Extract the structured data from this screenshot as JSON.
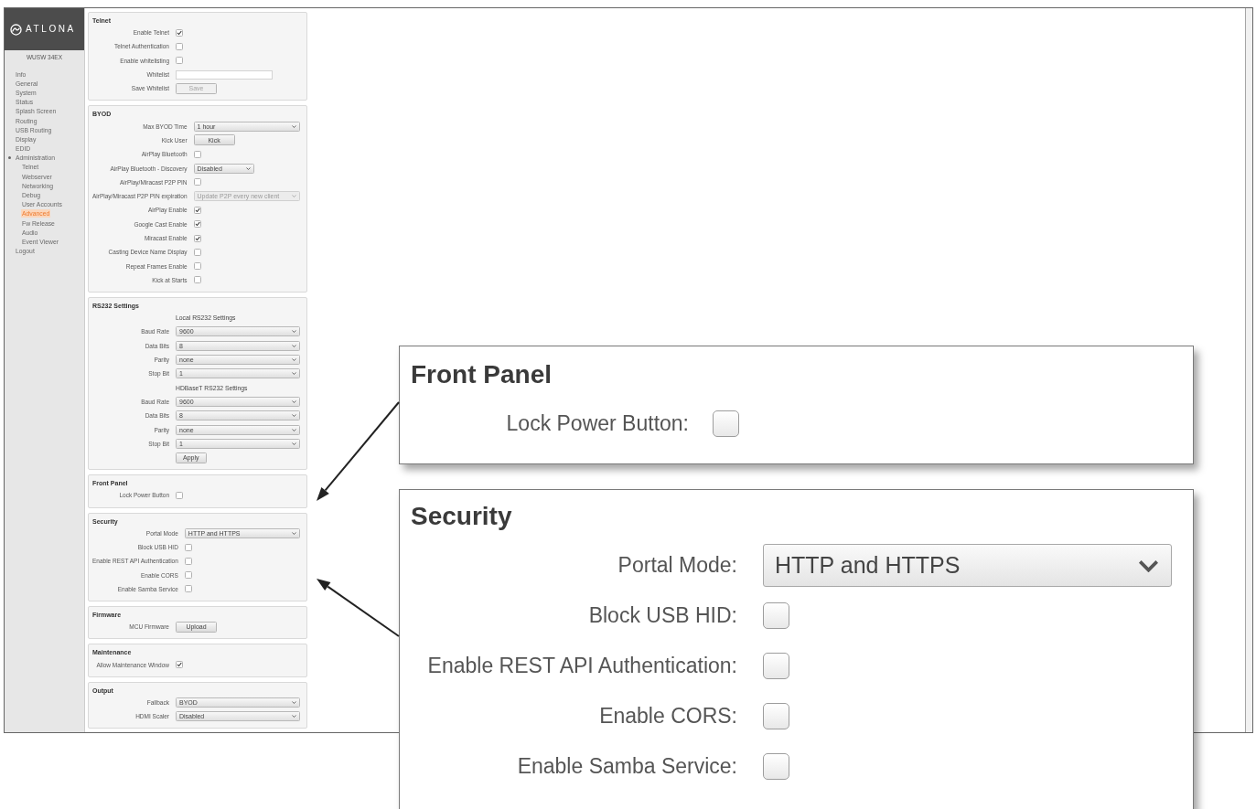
{
  "sidebar": {
    "logo": "ATLONA",
    "device": "WUSW 34EX",
    "items": [
      {
        "label": "Info",
        "selected": false,
        "expanded": false
      },
      {
        "label": "General",
        "selected": false,
        "expanded": false
      },
      {
        "label": "System",
        "selected": false,
        "expanded": false
      },
      {
        "label": "Status",
        "selected": false,
        "expanded": false
      },
      {
        "label": "Splash Screen",
        "selected": false,
        "expanded": false
      },
      {
        "label": "Routing",
        "selected": false,
        "expanded": false
      },
      {
        "label": "USB Routing",
        "selected": false,
        "expanded": false
      },
      {
        "label": "Display",
        "selected": false,
        "expanded": false
      },
      {
        "label": "EDID",
        "selected": false,
        "expanded": false
      },
      {
        "label": "Administration",
        "selected": false,
        "expanded": true,
        "children": [
          {
            "label": "Telnet",
            "selected": false
          },
          {
            "label": "Webserver",
            "selected": false
          },
          {
            "label": "Networking",
            "selected": false
          },
          {
            "label": "Debug",
            "selected": false
          },
          {
            "label": "User Accounts",
            "selected": false
          },
          {
            "label": "Advanced",
            "selected": true
          },
          {
            "label": "Fw Release",
            "selected": false
          },
          {
            "label": "Audio",
            "selected": false
          },
          {
            "label": "Event Viewer",
            "selected": false
          }
        ]
      },
      {
        "label": "Logout",
        "selected": false,
        "expanded": false
      }
    ]
  },
  "sections": [
    {
      "title": "Telnet",
      "rows": [
        {
          "kind": "checkbox",
          "label": "Enable Telnet",
          "checked": true
        },
        {
          "kind": "checkbox",
          "label": "Telnet Authentication",
          "checked": false
        },
        {
          "kind": "checkbox",
          "label": "Enable whitelisting",
          "checked": false
        },
        {
          "kind": "input",
          "label": "Whitelist"
        },
        {
          "kind": "button",
          "label": "Save Whitelist",
          "button": "Save",
          "disabled": true
        }
      ]
    },
    {
      "title": "BYOD",
      "rows": [
        {
          "kind": "select",
          "label": "Max BYOD Time",
          "value": "1 hour",
          "disabled": false
        },
        {
          "kind": "button",
          "label": "Kick User",
          "button": "Kick",
          "disabled": false
        },
        {
          "kind": "checkbox",
          "label": "AirPlay Bluetooth",
          "checked": false
        },
        {
          "kind": "select",
          "label": "AirPlay Bluetooth - Discovery",
          "value": "Disabled",
          "disabled": false
        },
        {
          "kind": "checkbox",
          "label": "AirPlay/Miracast P2P PIN",
          "checked": false
        },
        {
          "kind": "select",
          "label": "AirPlay/Miracast P2P PIN expiration",
          "value": "Update P2P every new client",
          "disabled": true
        },
        {
          "kind": "checkbox",
          "label": "AirPlay Enable",
          "checked": true
        },
        {
          "kind": "checkbox",
          "label": "Google Cast Enable",
          "checked": true
        },
        {
          "kind": "checkbox",
          "label": "Miracast Enable",
          "checked": true
        },
        {
          "kind": "checkbox",
          "label": "Casting Device Name Display",
          "checked": false
        },
        {
          "kind": "checkbox",
          "label": "Repeat Frames Enable",
          "checked": false
        },
        {
          "kind": "checkbox",
          "label": "Kick at Starts",
          "checked": false
        }
      ]
    },
    {
      "title": "RS232 Settings",
      "rows": [
        {
          "kind": "heading",
          "label": "Local RS232 Settings"
        },
        {
          "kind": "select",
          "label": "Baud Rate",
          "value": "9600",
          "disabled": false
        },
        {
          "kind": "select",
          "label": "Data Bits",
          "value": "8",
          "disabled": false
        },
        {
          "kind": "select",
          "label": "Parity",
          "value": "none",
          "disabled": false
        },
        {
          "kind": "select",
          "label": "Stop Bit",
          "value": "1",
          "disabled": false
        },
        {
          "kind": "heading",
          "label": "HDBaseT RS232 Settings"
        },
        {
          "kind": "select",
          "label": "Baud Rate",
          "value": "9600",
          "disabled": false
        },
        {
          "kind": "select",
          "label": "Data Bits",
          "value": "8",
          "disabled": false
        },
        {
          "kind": "select",
          "label": "Parity",
          "value": "none",
          "disabled": false
        },
        {
          "kind": "select",
          "label": "Stop Bit",
          "value": "1",
          "disabled": false
        },
        {
          "kind": "button",
          "button": "Apply",
          "disabled": false
        }
      ]
    },
    {
      "title": "Front Panel",
      "rows": [
        {
          "kind": "checkbox",
          "label": "Lock Power Button",
          "checked": false
        }
      ]
    },
    {
      "title": "Security",
      "rows": [
        {
          "kind": "select",
          "label": "Portal Mode",
          "value": "HTTP and HTTPS",
          "disabled": false
        },
        {
          "kind": "checkbox",
          "label": "Block USB HID",
          "checked": false
        },
        {
          "kind": "checkbox",
          "label": "Enable REST API Authentication",
          "checked": false
        },
        {
          "kind": "checkbox",
          "label": "Enable CORS",
          "checked": false
        },
        {
          "kind": "checkbox",
          "label": "Enable Samba Service",
          "checked": false
        }
      ]
    },
    {
      "title": "Firmware",
      "rows": [
        {
          "kind": "button",
          "label": "MCU Firmware",
          "button": "Upload",
          "disabled": false
        }
      ]
    },
    {
      "title": "Maintenance",
      "rows": [
        {
          "kind": "checkbox",
          "label": "Allow Maintenance Window",
          "checked": true
        }
      ]
    },
    {
      "title": "Output",
      "rows": [
        {
          "kind": "select",
          "label": "Fallback",
          "value": "BYOD",
          "disabled": false
        },
        {
          "kind": "select",
          "label": "HDMI Scaler",
          "value": "Disabled",
          "disabled": false
        }
      ]
    }
  ],
  "callouts": [
    {
      "title": "Front Panel",
      "rows": [
        {
          "kind": "checkbox",
          "label": "Lock Power Button:",
          "checked": false
        }
      ]
    },
    {
      "title": "Security",
      "rows": [
        {
          "kind": "select",
          "label": "Portal Mode:",
          "value": "HTTP and HTTPS"
        },
        {
          "kind": "checkbox",
          "label": "Block USB HID:",
          "checked": false
        },
        {
          "kind": "checkbox",
          "label": "Enable REST API Authentication:",
          "checked": false
        },
        {
          "kind": "checkbox",
          "label": "Enable CORS:",
          "checked": false
        },
        {
          "kind": "checkbox",
          "label": "Enable Samba Service:",
          "checked": false
        }
      ]
    }
  ]
}
